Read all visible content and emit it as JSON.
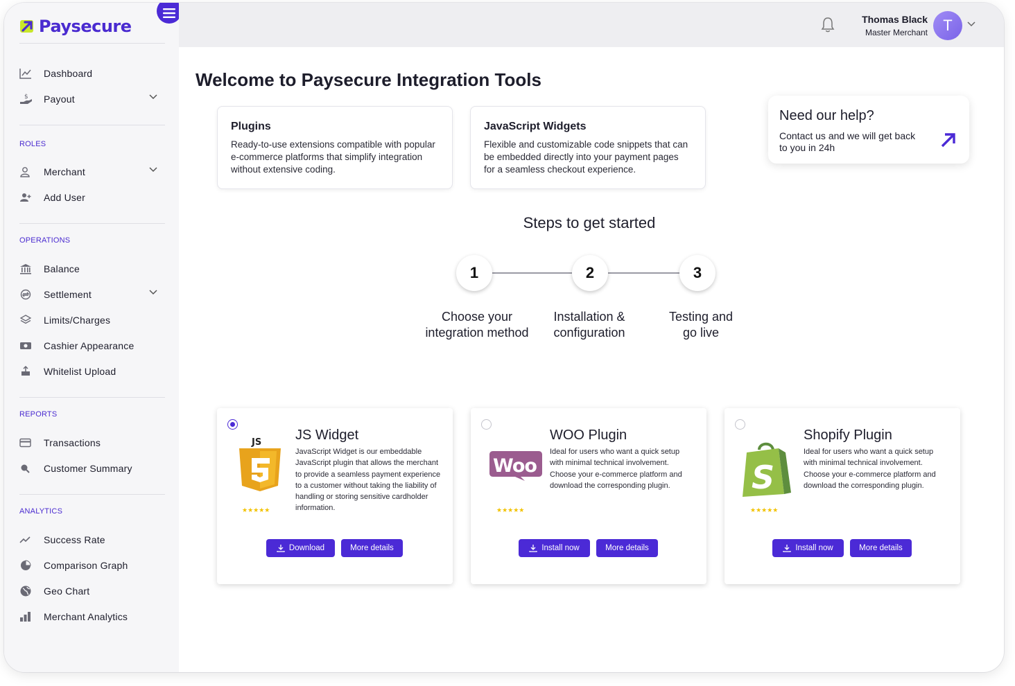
{
  "app": {
    "brand": "Paysecure"
  },
  "sidebar": {
    "top_items": [
      {
        "label": "Dashboard",
        "icon": "chart-line-icon"
      },
      {
        "label": "Payout",
        "icon": "hand-coin-icon",
        "has_submenu": true
      }
    ],
    "sections": [
      {
        "title": "ROLES",
        "items": [
          {
            "label": "Merchant",
            "icon": "user-icon",
            "has_submenu": true
          },
          {
            "label": "Add User",
            "icon": "user-plus-icon"
          }
        ]
      },
      {
        "title": "OPERATIONS",
        "items": [
          {
            "label": "Balance",
            "icon": "bank-icon"
          },
          {
            "label": "Settlement",
            "icon": "exchange-icon",
            "has_submenu": true
          },
          {
            "label": "Limits/Charges",
            "icon": "layers-icon"
          },
          {
            "label": "Cashier Appearance",
            "icon": "cash-icon"
          },
          {
            "label": "Whitelist Upload",
            "icon": "upload-icon"
          }
        ]
      },
      {
        "title": "REPORTS",
        "items": [
          {
            "label": "Transactions",
            "icon": "card-icon"
          },
          {
            "label": "Customer Summary",
            "icon": "search-user-icon"
          }
        ]
      },
      {
        "title": "ANALYTICS",
        "items": [
          {
            "label": "Success Rate",
            "icon": "trend-icon"
          },
          {
            "label": "Comparison Graph",
            "icon": "pie-icon"
          },
          {
            "label": "Geo Chart",
            "icon": "globe-icon"
          },
          {
            "label": "Merchant Analytics",
            "icon": "bar-chart-icon"
          }
        ]
      }
    ]
  },
  "header": {
    "user_name": "Thomas Black",
    "user_role": "Master Merchant",
    "avatar_initial": "T"
  },
  "main": {
    "title": "Welcome to Paysecure Integration Tools",
    "info_cards": [
      {
        "title": "Plugins",
        "text": "Ready-to-use extensions compatible with popular e-commerce platforms that simplify integration without extensive coding."
      },
      {
        "title": "JavaScript Widgets",
        "text": "Flexible and customizable code snippets that can be embedded directly into your payment pages for a seamless checkout experience."
      }
    ],
    "help": {
      "title": "Need our help?",
      "text": "Contact us and we will get back to you in 24h"
    },
    "steps_title": "Steps to get started",
    "steps": [
      {
        "number": "1",
        "label": "Choose your integration method"
      },
      {
        "number": "2",
        "label": "Installation & configuration"
      },
      {
        "number": "3",
        "label": "Testing and go live"
      }
    ],
    "integrations": [
      {
        "title": "JS Widget",
        "selected": true,
        "logo": "js-html5-logo",
        "rating": "★★★★★",
        "description": "JavaScript Widget is our embeddable JavaScript plugin that allows the merchant to provide a seamless payment experience to a customer without taking the liability of handling or storing sensitive cardholder information.",
        "primary_label": "Download",
        "secondary_label": "More details"
      },
      {
        "title": "WOO Plugin",
        "selected": false,
        "logo": "woocommerce-logo",
        "rating": "★★★★★",
        "description": "Ideal for users who want a quick setup with minimal technical involvement. Choose your e-commerce platform and download the corresponding plugin.",
        "primary_label": "Install now",
        "secondary_label": "More details"
      },
      {
        "title": "Shopify Plugin",
        "selected": false,
        "logo": "shopify-logo",
        "rating": "★★★★★",
        "description": "Ideal for users who want a quick setup with minimal technical involvement. Choose your e-commerce platform and download the corresponding plugin.",
        "primary_label": "Install now",
        "secondary_label": "More details"
      }
    ]
  },
  "colors": {
    "accent": "#4b2ad6",
    "sidebar_bg": "#f6f6f8",
    "header_bg": "#eeeef1",
    "star": "#f2c200"
  }
}
